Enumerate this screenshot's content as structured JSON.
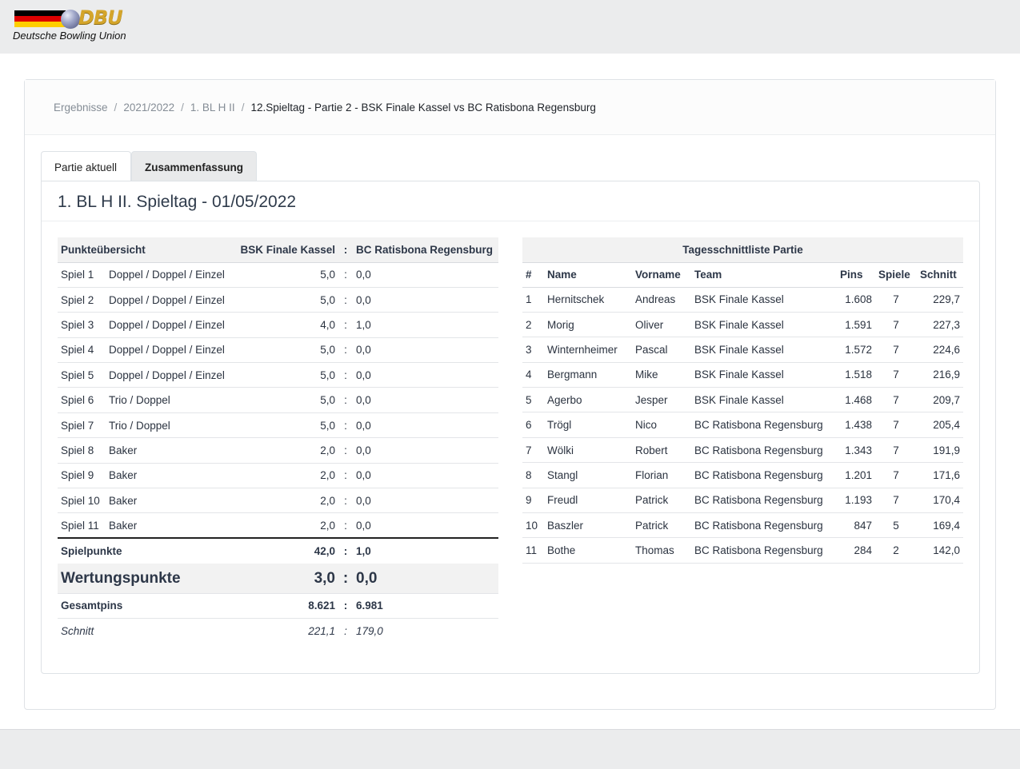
{
  "logo": {
    "brand": "DBU",
    "subtitle": "Deutsche Bowling Union"
  },
  "breadcrumb": {
    "items": [
      "Ergebnisse",
      "2021/2022",
      "1. BL H II"
    ],
    "active": "12.Spieltag - Partie 2 - BSK Finale Kassel vs BC Ratisbona Regensburg"
  },
  "tabs": {
    "partie_aktuell": "Partie aktuell",
    "zusammenfassung": "Zusammenfassung"
  },
  "panel_title": "1. BL H II. Spieltag - 01/05/2022",
  "points_table": {
    "header": {
      "label": "Punkteübersicht",
      "team_a": "BSK Finale Kassel",
      "colon": ":",
      "team_b": "BC Ratisbona Regensburg"
    },
    "rows": [
      {
        "spiel": "Spiel 1",
        "mode": "Doppel / Doppel / Einzel",
        "a": "5,0",
        "b": "0,0"
      },
      {
        "spiel": "Spiel 2",
        "mode": "Doppel / Doppel / Einzel",
        "a": "5,0",
        "b": "0,0"
      },
      {
        "spiel": "Spiel 3",
        "mode": "Doppel / Doppel / Einzel",
        "a": "4,0",
        "b": "1,0"
      },
      {
        "spiel": "Spiel 4",
        "mode": "Doppel / Doppel / Einzel",
        "a": "5,0",
        "b": "0,0"
      },
      {
        "spiel": "Spiel 5",
        "mode": "Doppel / Doppel / Einzel",
        "a": "5,0",
        "b": "0,0"
      },
      {
        "spiel": "Spiel 6",
        "mode": "Trio / Doppel",
        "a": "5,0",
        "b": "0,0"
      },
      {
        "spiel": "Spiel 7",
        "mode": "Trio / Doppel",
        "a": "5,0",
        "b": "0,0"
      },
      {
        "spiel": "Spiel 8",
        "mode": "Baker",
        "a": "2,0",
        "b": "0,0"
      },
      {
        "spiel": "Spiel 9",
        "mode": "Baker",
        "a": "2,0",
        "b": "0,0"
      },
      {
        "spiel": "Spiel 10",
        "mode": "Baker",
        "a": "2,0",
        "b": "0,0"
      },
      {
        "spiel": "Spiel 11",
        "mode": "Baker",
        "a": "2,0",
        "b": "0,0"
      }
    ],
    "spielpunkte": {
      "label": "Spielpunkte",
      "a": "42,0",
      "b": "1,0"
    },
    "wertungspunkte": {
      "label": "Wertungspunkte",
      "a": "3,0",
      "b": "0,0"
    },
    "gesamtpins": {
      "label": "Gesamtpins",
      "a": "8.621",
      "b": "6.981"
    },
    "schnitt": {
      "label": "Schnitt",
      "a": "221,1",
      "b": "179,0"
    }
  },
  "avg_table": {
    "caption": "Tagesschnittliste Partie",
    "headers": {
      "nr": "#",
      "name": "Name",
      "vorname": "Vorname",
      "team": "Team",
      "pins": "Pins",
      "spiele": "Spiele",
      "schnitt": "Schnitt"
    },
    "rows": [
      {
        "nr": "1",
        "name": "Hernitschek",
        "vorname": "Andreas",
        "team": "BSK Finale Kassel",
        "pins": "1.608",
        "spiele": "7",
        "schnitt": "229,7"
      },
      {
        "nr": "2",
        "name": "Morig",
        "vorname": "Oliver",
        "team": "BSK Finale Kassel",
        "pins": "1.591",
        "spiele": "7",
        "schnitt": "227,3"
      },
      {
        "nr": "3",
        "name": "Winternheimer",
        "vorname": "Pascal",
        "team": "BSK Finale Kassel",
        "pins": "1.572",
        "spiele": "7",
        "schnitt": "224,6"
      },
      {
        "nr": "4",
        "name": "Bergmann",
        "vorname": "Mike",
        "team": "BSK Finale Kassel",
        "pins": "1.518",
        "spiele": "7",
        "schnitt": "216,9"
      },
      {
        "nr": "5",
        "name": "Agerbo",
        "vorname": "Jesper",
        "team": "BSK Finale Kassel",
        "pins": "1.468",
        "spiele": "7",
        "schnitt": "209,7"
      },
      {
        "nr": "6",
        "name": "Trögl",
        "vorname": "Nico",
        "team": "BC Ratisbona Regensburg",
        "pins": "1.438",
        "spiele": "7",
        "schnitt": "205,4"
      },
      {
        "nr": "7",
        "name": "Wölki",
        "vorname": "Robert",
        "team": "BC Ratisbona Regensburg",
        "pins": "1.343",
        "spiele": "7",
        "schnitt": "191,9"
      },
      {
        "nr": "8",
        "name": "Stangl",
        "vorname": "Florian",
        "team": "BC Ratisbona Regensburg",
        "pins": "1.201",
        "spiele": "7",
        "schnitt": "171,6"
      },
      {
        "nr": "9",
        "name": "Freudl",
        "vorname": "Patrick",
        "team": "BC Ratisbona Regensburg",
        "pins": "1.193",
        "spiele": "7",
        "schnitt": "170,4"
      },
      {
        "nr": "10",
        "name": "Baszler",
        "vorname": "Patrick",
        "team": "BC Ratisbona Regensburg",
        "pins": "847",
        "spiele": "5",
        "schnitt": "169,4"
      },
      {
        "nr": "11",
        "name": "Bothe",
        "vorname": "Thomas",
        "team": "BC Ratisbona Regensburg",
        "pins": "284",
        "spiele": "2",
        "schnitt": "142,0"
      }
    ]
  },
  "colors": {
    "flag": [
      "#000000",
      "#dd0000",
      "#ffce00"
    ],
    "logo_gold": "#d4a52b"
  }
}
